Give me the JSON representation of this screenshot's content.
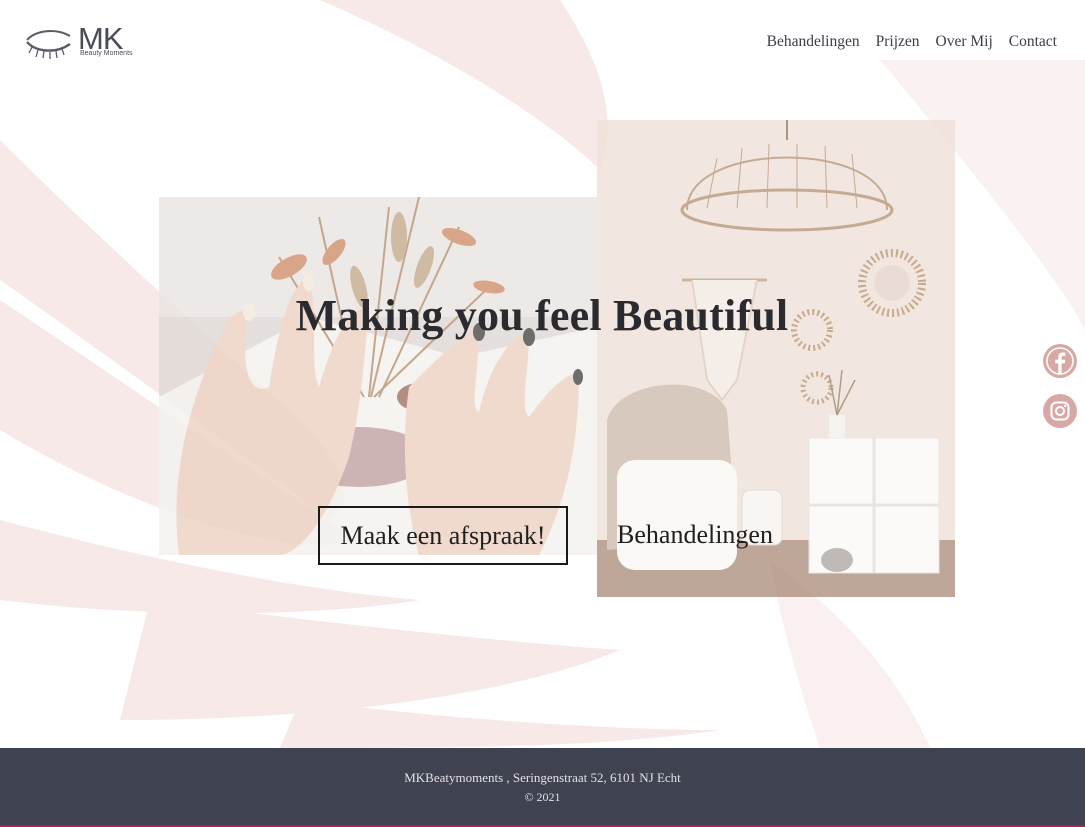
{
  "brand": {
    "logo_letters": "MK",
    "tagline": "Beauty Moments"
  },
  "nav": {
    "items": [
      "Behandelingen",
      "Prijzen",
      "Over Mij",
      "Contact"
    ]
  },
  "hero": {
    "title": "Making you feel Beautiful",
    "cta_label": "Maak een afspraak!",
    "secondary_label": "Behandelingen"
  },
  "social": {
    "items": [
      {
        "name": "facebook-icon"
      },
      {
        "name": "instagram-icon"
      }
    ],
    "icon_color": "#d8a8a4"
  },
  "footer": {
    "address": "MKBeatymoments , Seringenstraat 52, 6101 NJ Echt",
    "copyright": "© 2021"
  },
  "colors": {
    "wing": "#f5e6e4",
    "footer_bg": "#3f4251",
    "footer_accent": "#b01a5a",
    "text_dark": "#2b2b2f"
  }
}
